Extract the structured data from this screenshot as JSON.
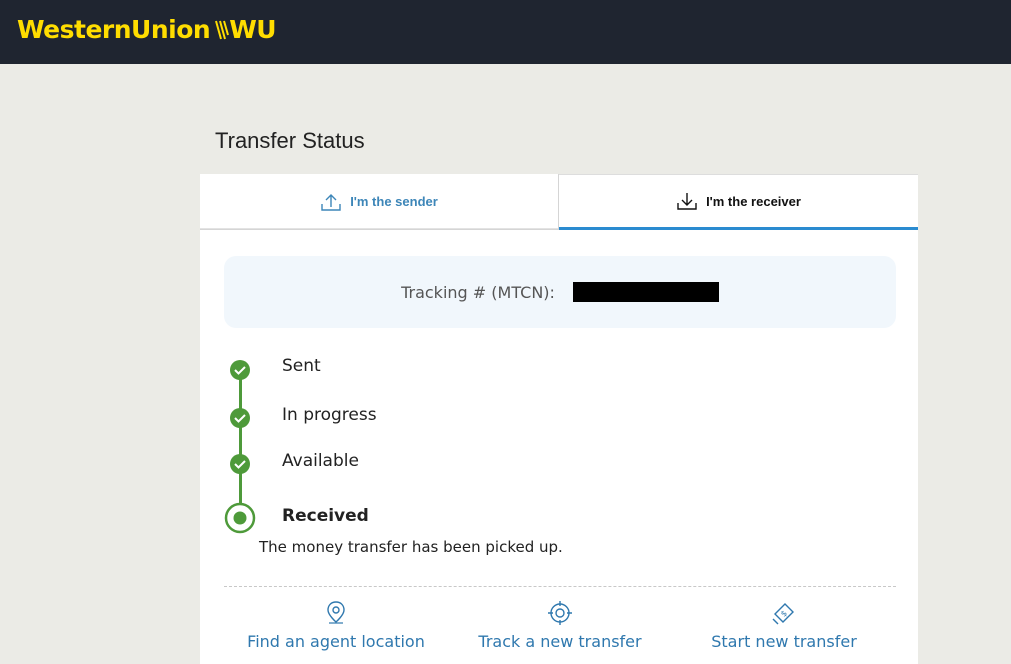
{
  "header": {
    "logo_text": "WesternUnion",
    "logo_mark_text": "WU",
    "brand_color": "#ffdd00",
    "bar_color": "#1f2530"
  },
  "page": {
    "title": "Transfer Status"
  },
  "tabs": [
    {
      "label": "I'm the sender",
      "icon": "upload-icon",
      "active": false
    },
    {
      "label": "I'm the receiver",
      "icon": "download-icon",
      "active": true
    }
  ],
  "tracking": {
    "label": "Tracking # (MTCN):"
  },
  "timeline": {
    "steps": [
      {
        "label": "Sent",
        "status": "complete"
      },
      {
        "label": "In progress",
        "status": "complete"
      },
      {
        "label": "Available",
        "status": "complete"
      },
      {
        "label": "Received",
        "status": "current"
      }
    ],
    "description": "The money transfer has been picked up.",
    "complete_color": "#4e9a3a"
  },
  "actions": [
    {
      "label": "Find an agent location",
      "icon": "location-pin-icon"
    },
    {
      "label": "Track a new transfer",
      "icon": "target-icon"
    },
    {
      "label": "Start new transfer",
      "icon": "money-transfer-icon"
    }
  ]
}
